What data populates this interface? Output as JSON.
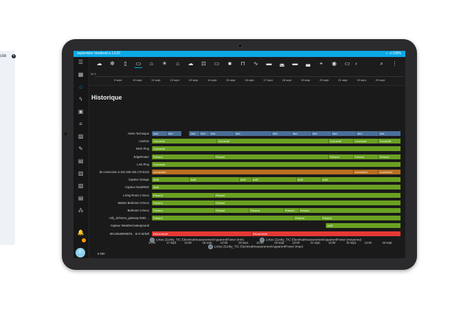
{
  "background": {
    "partial_label": "cité"
  },
  "status": {
    "time": "septembre Vendredi à 13:20",
    "right": "⌁ .ıl 100%"
  },
  "toolbar": {
    "icons": [
      "weather-icon",
      "fan-icon",
      "phone-icon",
      "tv-icon",
      "home-icon",
      "sun-icon",
      "garage-icon",
      "cloud-icon",
      "car-icon",
      "vr-icon",
      "camera-icon",
      "lamp-icon",
      "wave-icon",
      "stove-icon",
      "bathtub-icon",
      "bed-icon",
      "sofa-icon",
      "location-icon",
      "eye-icon",
      "media-icon",
      "chevron-right-icon",
      "search-icon",
      "more-icon"
    ]
  },
  "timeline": {
    "axis_value": "56.3",
    "ticks": [
      "9 sept.",
      "10 sept.",
      "11 sept.",
      "12 sept.",
      "13 sept.",
      "14 sept.",
      "15 sept.",
      "16 sept.",
      "17 sept.",
      "18 sept.",
      "19 sept.",
      "20 sept.",
      "21 sept.",
      "22 sept.",
      "23 sept."
    ]
  },
  "page": {
    "title": "Historique"
  },
  "history": {
    "rows": [
      {
        "label": "Alerte Technique",
        "segments": [
          [
            "Vert",
            0,
            0.06,
            "#4a6f98"
          ],
          [
            "Vert",
            0.06,
            0.12,
            "#4a6f98"
          ],
          [
            "Vert",
            0.15,
            0.19,
            "#4a6f98"
          ],
          [
            "Vert",
            0.19,
            0.23,
            "#4a6f98"
          ],
          [
            "Vert",
            0.23,
            0.33,
            "#4a6f98"
          ],
          [
            "Vert",
            0.33,
            0.48,
            "#4a6f98"
          ],
          [
            "Vert",
            0.48,
            0.56,
            "#4a6f98"
          ],
          [
            "Vert",
            0.56,
            0.64,
            "#4a6f98"
          ],
          [
            "Vert",
            0.64,
            0.72,
            "#4a6f98"
          ],
          [
            "Vert",
            0.72,
            0.82,
            "#4a6f98"
          ],
          [
            "Vert",
            0.82,
            0.91,
            "#4a6f98"
          ],
          [
            "Vert",
            0.91,
            1,
            "#4a6f98"
          ]
        ]
      },
      {
        "label": "Linebox",
        "segments": [
          [
            "Connecté",
            0,
            0.26,
            "#6aa121"
          ],
          [
            "Connecté",
            0.26,
            0.71,
            "#6aa121"
          ],
          [
            "Connecté",
            0.71,
            0.81,
            "#6aa121"
          ],
          [
            "Connecté",
            0.81,
            0.91,
            "#6aa121"
          ],
          [
            "Connecté",
            0.91,
            1,
            "#6aa121"
          ]
        ]
      },
      {
        "label": "WAN Ping",
        "segments": [
          [
            "Connecté",
            0,
            1,
            "#6aa121"
          ]
        ]
      },
      {
        "label": "EdgeRouter",
        "segments": [
          [
            "Présent",
            0,
            0.25,
            "#6aa121"
          ],
          [
            "Présent",
            0.25,
            0.71,
            "#6aa121"
          ],
          [
            "Présent",
            0.71,
            0.81,
            "#6aa121"
          ],
          [
            "Présent",
            0.81,
            0.91,
            "#6aa121"
          ],
          [
            "Présent",
            0.91,
            1,
            "#6aa121"
          ]
        ]
      },
      {
        "label": "LAN Ping",
        "segments": [
          [
            "Connecté",
            0,
            1,
            "#6aa121"
          ]
        ]
      },
      {
        "label": "Ile connection à 192.168.100.170:8123",
        "segments": [
          [
            "connected",
            0,
            0.81,
            "#b86f1f"
          ],
          [
            "connected",
            0.81,
            0.91,
            "#b86f1f"
          ],
          [
            "connected",
            0.91,
            1,
            "#b86f1f"
          ]
        ]
      },
      {
        "label": "Capteur Garage",
        "segments": [
          [
            "Actif",
            0,
            0.15,
            "#6aa121"
          ],
          [
            "Actif",
            0.15,
            0.35,
            "#6aa121"
          ],
          [
            "Actif",
            0.35,
            0.4,
            "#6aa121"
          ],
          [
            "Actif",
            0.4,
            0.58,
            "#6aa121"
          ],
          [
            "Actif",
            0.58,
            0.68,
            "#6aa121"
          ],
          [
            "Actif",
            0.68,
            1,
            "#6aa121"
          ]
        ]
      },
      {
        "label": "Capteur NodeRED",
        "segments": [
          [
            "Actif",
            0,
            1,
            "#6aa121"
          ]
        ]
      },
      {
        "label": "Living Room 1 Deco",
        "segments": [
          [
            "Présent",
            0,
            0.25,
            "#6aa121"
          ],
          [
            "Présent",
            0.25,
            1,
            "#6aa121"
          ]
        ]
      },
      {
        "label": "Master Bedroom 3 Deco",
        "segments": [
          [
            "Présent",
            0,
            0.25,
            "#6aa121"
          ],
          [
            "Présent",
            0.25,
            1,
            "#6aa121"
          ]
        ]
      },
      {
        "label": "Bedroom 2 Deco",
        "segments": [
          [
            "Présent",
            0,
            0.25,
            "#6aa121"
          ],
          [
            "Présent",
            0.25,
            0.39,
            "#6aa121"
          ],
          [
            "Présent",
            0.39,
            0.53,
            "#6aa121"
          ],
          [
            "Présent",
            0.53,
            0.59,
            "#6aa121"
          ],
          [
            "Présent",
            0.59,
            1,
            "#6aa121"
          ]
        ]
      },
      {
        "label": "nrfy_Zehores_gateway 0063 ...",
        "segments": [
          [
            "Présent",
            0,
            0.57,
            "#6aa121"
          ],
          [
            "Présent",
            0.57,
            0.68,
            "#6aa121"
          ],
          [
            "Présent",
            0.68,
            1,
            "#6aa121"
          ]
        ]
      },
      {
        "label": "Capteur WeatherUnderground",
        "segments": [
          [
            "Actif",
            0.7,
            1,
            "#6aa121"
          ]
        ]
      },
      {
        "label": "001c5628004875... Ik nl Sirkell",
        "segments": [
          [
            "Déconnecté",
            0,
            0.4,
            "#e53935"
          ],
          [
            "Déconnecté",
            0.4,
            1,
            "#e53935"
          ]
        ]
      }
    ],
    "x_ticks": [
      "12:00",
      "17 sept.",
      "12:00",
      "18 sept.",
      "12:00",
      "19 sept.",
      "12:00",
      "20 sept.",
      "12:00",
      "21 sept.",
      "12:00",
      "22 sept.",
      "12:00",
      "23 sept."
    ]
  },
  "legend": {
    "items": [
      "LiXee ZLinky_TIC ElectricalmeasurementApparentPower (min)",
      "LiXee ZLinky_TIC ElectricalmeasurementApparentPower (moyenne)",
      "LiXee ZLinky_TIC ElectricalmeasurementApparentPower (max)"
    ]
  },
  "power_axis": {
    "top_value": "8 000"
  },
  "user": {
    "initial": "F"
  }
}
